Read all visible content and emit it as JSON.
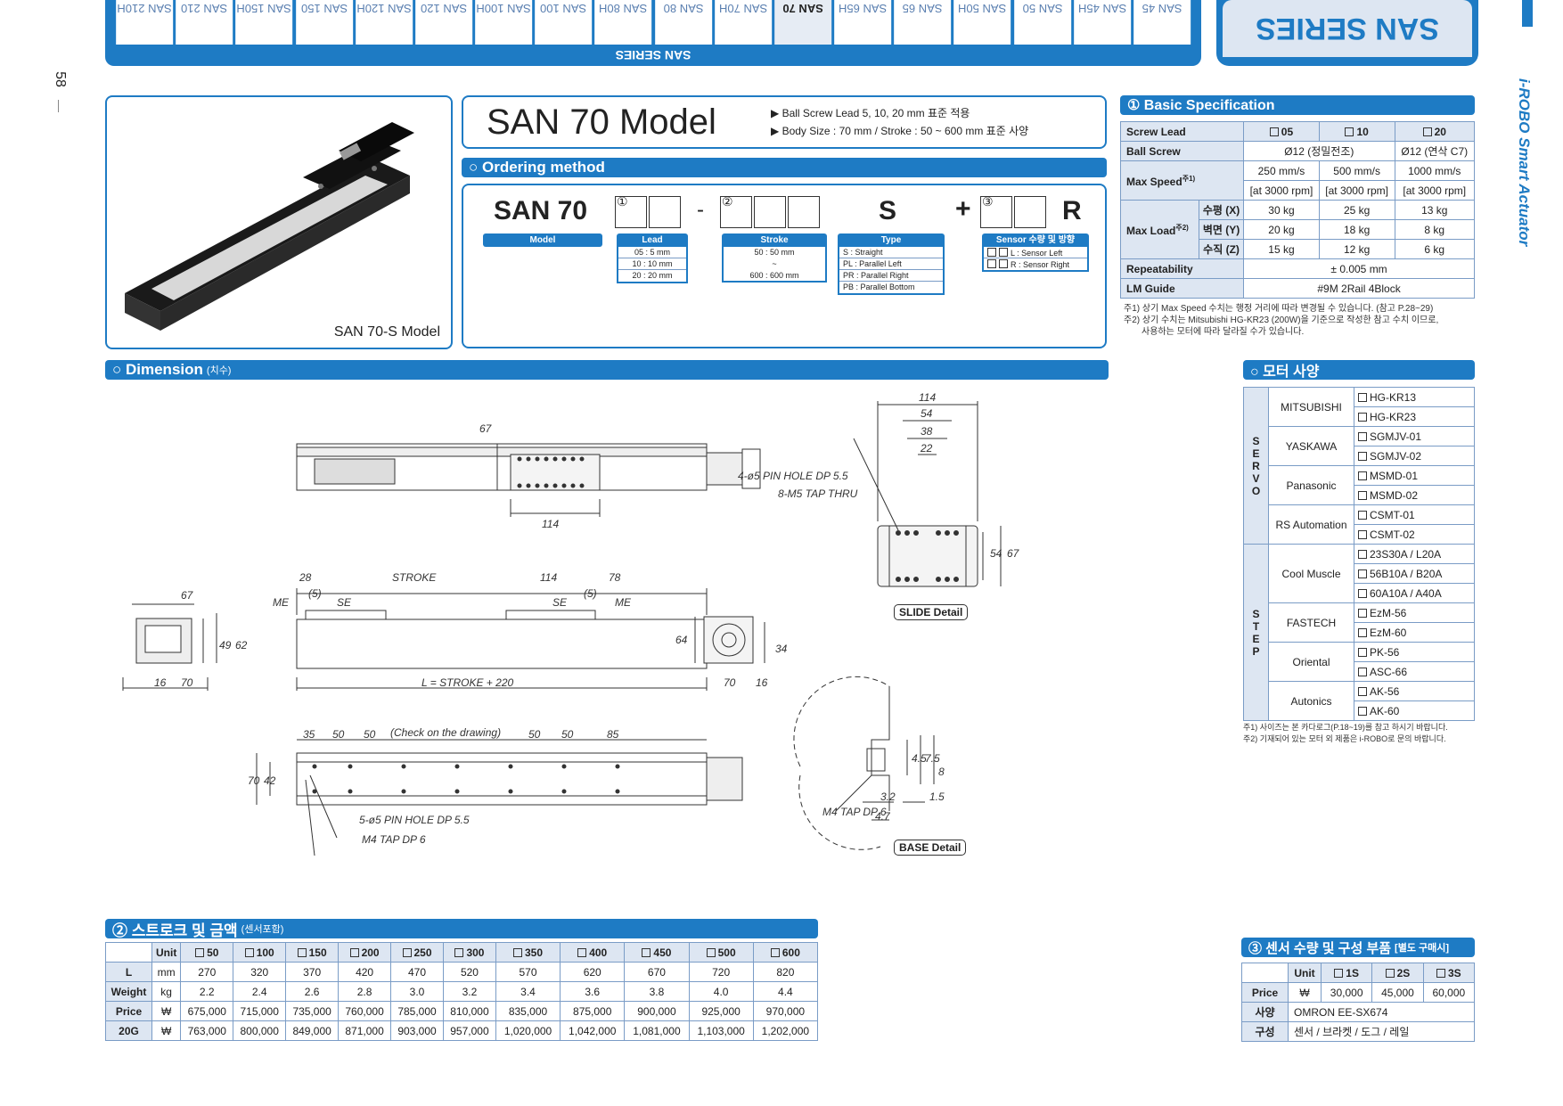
{
  "header": {
    "tabs": [
      "SAN 210H",
      "SAN 210",
      "SAN 150H",
      "SAN 150",
      "SAN 120H",
      "SAN 120",
      "SAN 100H",
      "SAN 100",
      "SAN 80H",
      "SAN 80",
      "SAN 70H",
      "SAN 70",
      "SAN 65H",
      "SAN 65",
      "SAN 50H",
      "SAN 50",
      "SAN 45H",
      "SAN 45"
    ],
    "active_tab": "SAN 70",
    "series_label": "SAN SERIES",
    "right_tab": "SAN SERIES",
    "side_title": "i-ROBO Smart Actuator",
    "page_number": "58"
  },
  "product": {
    "image_caption": "SAN 70-S Model",
    "model_title": "SAN 70 Model",
    "bullets": [
      "▶ Ball Screw Lead 5, 10, 20 mm 표준 적용",
      "▶ Body Size : 70 mm / Stroke : 50 ~ 600 mm 표준 사양"
    ]
  },
  "ordering": {
    "title": "○ Ordering method",
    "model_code": "SAN 70",
    "dash": "-",
    "type_code": "S",
    "plus": "+",
    "suffix": "R",
    "markers": [
      "①",
      "②",
      "③"
    ],
    "labels": {
      "model": "Model",
      "lead": "Lead",
      "stroke": "Stroke",
      "type": "Type",
      "sensor": "Sensor 수량 및 방향"
    },
    "lead_options": [
      "05 : 5 mm",
      "10 : 10 mm",
      "20 : 20 mm"
    ],
    "stroke_options": [
      "50 : 50 mm",
      "~",
      "600 : 600 mm"
    ],
    "type_options": [
      "S : Straight",
      "PL : Parallel Left",
      "PR : Parallel Right",
      "PB : Parallel Bottom"
    ],
    "sensor_options": [
      "L : Sensor Left",
      "R : Sensor Right"
    ]
  },
  "basic_spec": {
    "title": "① Basic Specification",
    "headers": [
      "Screw Lead",
      "05",
      "10",
      "20"
    ],
    "ball_screw": {
      "label": "Ball Screw",
      "precision": "Ø12 (정밀전조)",
      "c7": "Ø12 (연삭 C7)"
    },
    "max_speed": {
      "label": "Max Speed",
      "note": "주1)",
      "values": [
        "250 mm/s",
        "500 mm/s",
        "1000 mm/s"
      ],
      "rpm": [
        "[at 3000 rpm]",
        "[at 3000 rpm]",
        "[at 3000 rpm]"
      ]
    },
    "max_load": {
      "label": "Max Load",
      "note": "주2)",
      "rows": [
        {
          "dir": "수평 (X)",
          "values": [
            "30 kg",
            "25 kg",
            "13 kg"
          ]
        },
        {
          "dir": "벽면 (Y)",
          "values": [
            "20 kg",
            "18 kg",
            "8 kg"
          ]
        },
        {
          "dir": "수직 (Z)",
          "values": [
            "15 kg",
            "12 kg",
            "6 kg"
          ]
        }
      ]
    },
    "repeatability": {
      "label": "Repeatability",
      "value": "± 0.005 mm"
    },
    "lm_guide": {
      "label": "LM Guide",
      "value": "#9M 2Rail 4Block"
    },
    "notes": [
      "주1) 상기 Max Speed 수치는 행정 거리에 따라 변경될 수 있습니다. (참고 P.28~29)",
      "주2) 상기 수치는 Mitsubishi HG-KR23 (200W)을 기준으로 작성한 참고 수치 이므로,",
      "사용하는 모터에 따라 달라질 수가 있습니다."
    ]
  },
  "motor": {
    "title": "○ 모터 사양",
    "servo_label": [
      "S",
      "E",
      "R",
      "V",
      "O"
    ],
    "step_label": [
      "S",
      "T",
      "E",
      "P"
    ],
    "servo": [
      {
        "brand": "MITSUBISHI",
        "models": [
          "HG-KR13",
          "HG-KR23"
        ]
      },
      {
        "brand": "YASKAWA",
        "models": [
          "SGMJV-01",
          "SGMJV-02"
        ]
      },
      {
        "brand": "Panasonic",
        "models": [
          "MSMD-01",
          "MSMD-02"
        ]
      },
      {
        "brand": "RS Automation",
        "models": [
          "CSMT-01",
          "CSMT-02"
        ]
      }
    ],
    "step": [
      {
        "brand": "Cool Muscle",
        "models": [
          "23S30A / L20A",
          "56B10A / B20A",
          "60A10A / A40A"
        ]
      },
      {
        "brand": "FASTECH",
        "models": [
          "EzM-56",
          "EzM-60"
        ]
      },
      {
        "brand": "Oriental",
        "models": [
          "PK-56",
          "ASC-66"
        ]
      },
      {
        "brand": "Autonics",
        "models": [
          "AK-56",
          "AK-60"
        ]
      }
    ],
    "notes": [
      "주1) 사이즈는 본 카다로그(P.18~19)를 참고 하시기 바랍니다.",
      "주2) 기재되어 있는 모터 외 제품은 i-ROBO로 문의 바랍니다."
    ]
  },
  "dimension": {
    "title": "○ Dimension",
    "subtitle": "(치수)",
    "labels": {
      "d67": "67",
      "d114": "114",
      "d54": "54",
      "d38": "38",
      "d22": "22",
      "pin_hole": "4-ø5 PIN HOLE DP 5.5",
      "tap_thru": "8-M5 TAP THRU",
      "slide_detail": "SLIDE Detail",
      "base_detail": "BASE Detail",
      "d28": "28",
      "stroke": "STROKE",
      "d78": "78",
      "me": "ME",
      "se": "SE",
      "d5": "(5)",
      "d49": "49",
      "d62": "62",
      "d16": "16",
      "d70": "70",
      "l_formula": "L = STROKE + 220",
      "d64": "64",
      "d34": "34",
      "d35": "35",
      "d50": "50",
      "check": "(Check on the drawing)",
      "d85": "85",
      "d42": "42",
      "pin_hole5": "5-ø5 PIN HOLE DP 5.5",
      "m4_tap": "M4 TAP DP 6",
      "d4_5": "4.5",
      "d7_5": "7.5",
      "d8": "8",
      "d3_2": "3.2",
      "d1_5": "1.5",
      "d4_7": "4.7"
    }
  },
  "stroke_price": {
    "title": "② 스트로크 및 금액",
    "subtitle": "(센서포함)",
    "headers": [
      "Unit",
      "50",
      "100",
      "150",
      "200",
      "250",
      "300",
      "350",
      "400",
      "450",
      "500",
      "600"
    ],
    "rows": [
      {
        "label": "L",
        "unit": "mm",
        "values": [
          "270",
          "320",
          "370",
          "420",
          "470",
          "520",
          "570",
          "620",
          "670",
          "720",
          "820"
        ]
      },
      {
        "label": "Weight",
        "unit": "kg",
        "values": [
          "2.2",
          "2.4",
          "2.6",
          "2.8",
          "3.0",
          "3.2",
          "3.4",
          "3.6",
          "3.8",
          "4.0",
          "4.4"
        ]
      },
      {
        "label": "Price",
        "unit": "₩",
        "values": [
          "675,000",
          "715,000",
          "735,000",
          "760,000",
          "785,000",
          "810,000",
          "835,000",
          "875,000",
          "900,000",
          "925,000",
          "970,000"
        ]
      },
      {
        "label": "20G",
        "unit": "₩",
        "values": [
          "763,000",
          "800,000",
          "849,000",
          "871,000",
          "903,000",
          "957,000",
          "1,020,000",
          "1,042,000",
          "1,081,000",
          "1,103,000",
          "1,202,000"
        ]
      }
    ]
  },
  "sensor": {
    "title": "③ 센서 수량 및 구성 부품",
    "subtitle": "[별도 구매시]",
    "headers": [
      "Unit",
      "1S",
      "2S",
      "3S"
    ],
    "price": {
      "label": "Price",
      "unit": "₩",
      "values": [
        "30,000",
        "45,000",
        "60,000"
      ]
    },
    "spec": {
      "label": "사양",
      "value": "OMRON   EE-SX674"
    },
    "parts": {
      "label": "구성",
      "value": "센서 / 브라켓 / 도그 / 레일"
    }
  }
}
